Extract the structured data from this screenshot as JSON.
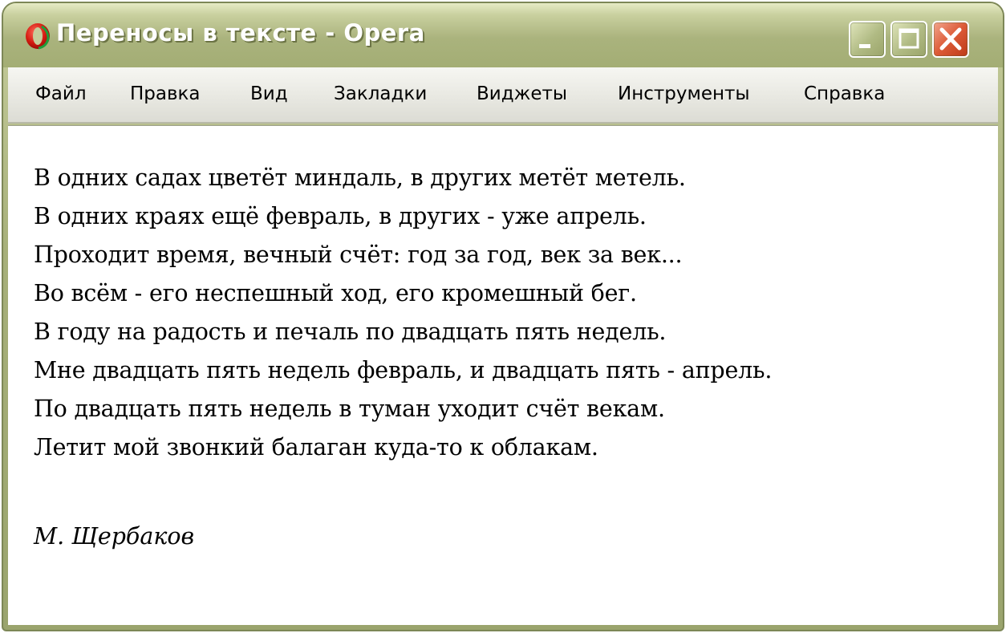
{
  "window": {
    "title": "Переносы в тексте - Opera",
    "controls": [
      "minimize-icon",
      "maximize-icon",
      "close-icon"
    ],
    "accent_color": "#a7b07a",
    "close_color": "#dc5a37"
  },
  "app_icon": "opera-logo-icon",
  "menu": {
    "items": [
      {
        "label": "Файл"
      },
      {
        "label": "Правка"
      },
      {
        "label": "Вид"
      },
      {
        "label": "Закладки"
      },
      {
        "label": "Виджеты"
      },
      {
        "label": "Инструменты"
      },
      {
        "label": "Справка"
      }
    ]
  },
  "poem": {
    "lines": [
      "В одних садах цветёт миндаль, в других метёт метель.",
      "В одних краях ещё февраль, в других - уже апрель.",
      "Проходит время, вечный счёт: год за год, век за век...",
      "Во всём - его неспешный ход, его кромешный бег.",
      "В году на радость и печаль по двадцать пять недель.",
      "Мне двадцать пять недель февраль, и двадцать пять - апрель.",
      "По двадцать пять недель в туман уходит счёт векам.",
      "Летит мой звонкий балаган куда-то к облакам."
    ],
    "author": "М. Щербаков"
  }
}
